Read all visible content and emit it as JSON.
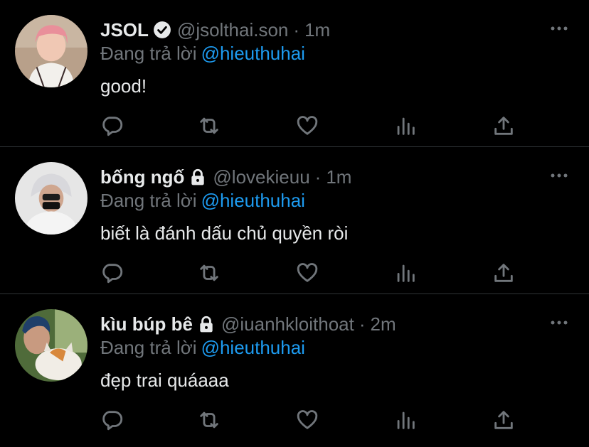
{
  "colors": {
    "background": "#000000",
    "text": "#e7e9ea",
    "muted": "#71767b",
    "link": "#1d9bf0",
    "divider": "#2f3336"
  },
  "reply_prefix": "Đang trả lời",
  "tweets": [
    {
      "name": "JSOL",
      "badge": "verified-icon",
      "handle": "@jsolthai.son",
      "separator": "·",
      "time": "1m",
      "reply_to": "@hieuthuhai",
      "text": "good!"
    },
    {
      "name": "bống ngố",
      "badge": "lock-icon",
      "handle": "@lovekieuu",
      "separator": "·",
      "time": "1m",
      "reply_to": "@hieuthuhai",
      "text": "biết là đánh dấu chủ quyền ròi"
    },
    {
      "name": "kìu búp bê",
      "badge": "lock-icon",
      "handle": "@iuanhkloithoat",
      "separator": "·",
      "time": "2m",
      "reply_to": "@hieuthuhai",
      "text": "đẹp trai quáaaa"
    }
  ]
}
